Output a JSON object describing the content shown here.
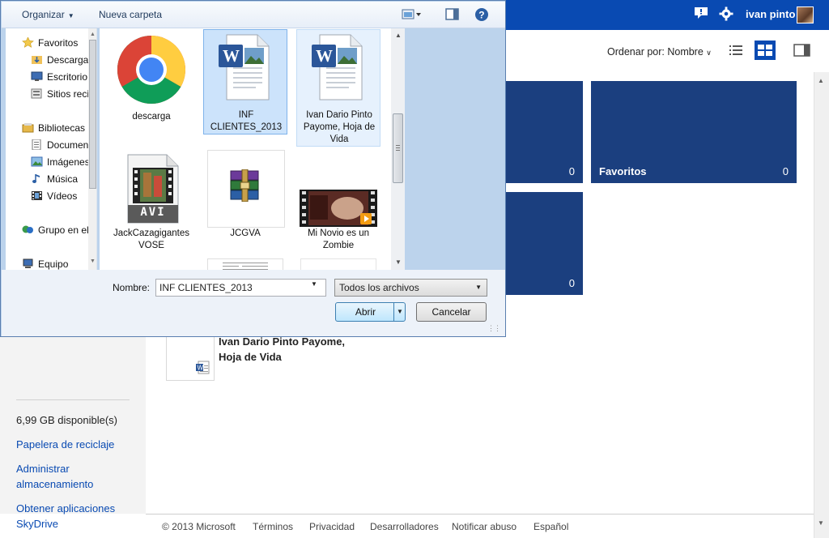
{
  "skydrive": {
    "user_name": "ivan pinto",
    "sort": {
      "label": "Ordenar por: Nombre"
    },
    "tiles": [
      {
        "name": "",
        "count": "0"
      },
      {
        "name": "Favoritos",
        "count": "0"
      },
      {
        "name": "",
        "count": "0"
      }
    ],
    "document": {
      "title_line1": "Ivan Dario Pinto Payome,",
      "title_line2": "Hoja de Vida"
    },
    "sidebar": {
      "storage": "6,99 GB disponible(s)",
      "recycle": "Papelera de reciclaje",
      "manage_line1": "Administrar",
      "manage_line2": "almacenamiento",
      "apps_line1": "Obtener aplicaciones",
      "apps_line2": "SkyDrive"
    },
    "footer": [
      "© 2013 Microsoft",
      "Términos",
      "Privacidad",
      "Desarrolladores",
      "Notificar abuso",
      "Español"
    ]
  },
  "dialog": {
    "toolbar": {
      "organize": "Organizar",
      "new_folder": "Nueva carpeta"
    },
    "nav": {
      "favorites": "Favoritos",
      "downloads": "Descargas",
      "desktop": "Escritorio",
      "recent": "Sitios recientes",
      "libraries": "Bibliotecas",
      "documents": "Documentos",
      "images": "Imágenes",
      "music": "Música",
      "videos": "Vídeos",
      "homegroup": "Grupo en el hogar",
      "computer": "Equipo"
    },
    "files": {
      "f1": "descarga",
      "f2_line1": "INF",
      "f2_line2": "CLIENTES_2013",
      "f3_line1": "Ivan Dario Pinto",
      "f3_line2": "Payome, Hoja de",
      "f3_line3": "Vida",
      "f4_badge": "AVI",
      "f4_line1": "JackCazagigantes",
      "f4_line2": "VOSE",
      "f5": "JCGVA",
      "f6_line1": "Mi Novio es un",
      "f6_line2": "Zombie"
    },
    "name_label": "Nombre:",
    "filename_value": "INF CLIENTES_2013",
    "filter": "Todos los archivos",
    "open_label": "Abrir",
    "cancel_label": "Cancelar"
  }
}
